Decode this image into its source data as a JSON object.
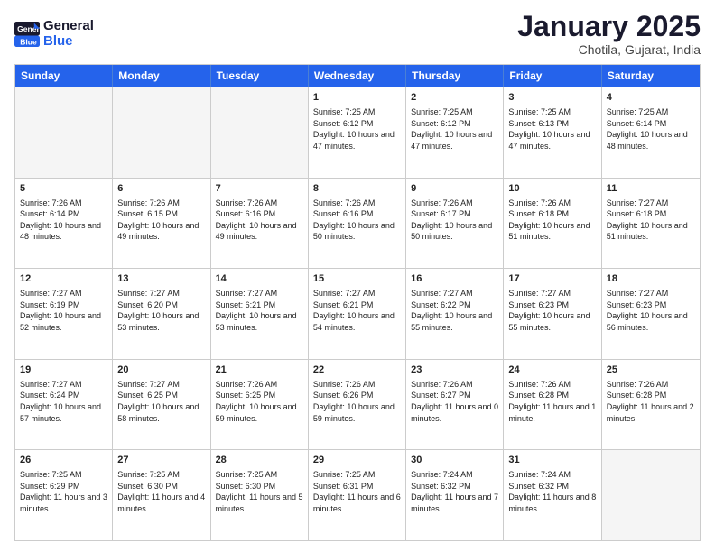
{
  "logo": {
    "text1": "General",
    "text2": "Blue"
  },
  "header": {
    "title": "January 2025",
    "location": "Chotila, Gujarat, India"
  },
  "weekdays": [
    "Sunday",
    "Monday",
    "Tuesday",
    "Wednesday",
    "Thursday",
    "Friday",
    "Saturday"
  ],
  "rows": [
    [
      {
        "day": "",
        "sunrise": "",
        "sunset": "",
        "daylight": "",
        "empty": true
      },
      {
        "day": "",
        "sunrise": "",
        "sunset": "",
        "daylight": "",
        "empty": true
      },
      {
        "day": "",
        "sunrise": "",
        "sunset": "",
        "daylight": "",
        "empty": true
      },
      {
        "day": "1",
        "sunrise": "Sunrise: 7:25 AM",
        "sunset": "Sunset: 6:12 PM",
        "daylight": "Daylight: 10 hours and 47 minutes.",
        "empty": false
      },
      {
        "day": "2",
        "sunrise": "Sunrise: 7:25 AM",
        "sunset": "Sunset: 6:12 PM",
        "daylight": "Daylight: 10 hours and 47 minutes.",
        "empty": false
      },
      {
        "day": "3",
        "sunrise": "Sunrise: 7:25 AM",
        "sunset": "Sunset: 6:13 PM",
        "daylight": "Daylight: 10 hours and 47 minutes.",
        "empty": false
      },
      {
        "day": "4",
        "sunrise": "Sunrise: 7:25 AM",
        "sunset": "Sunset: 6:14 PM",
        "daylight": "Daylight: 10 hours and 48 minutes.",
        "empty": false
      }
    ],
    [
      {
        "day": "5",
        "sunrise": "Sunrise: 7:26 AM",
        "sunset": "Sunset: 6:14 PM",
        "daylight": "Daylight: 10 hours and 48 minutes.",
        "empty": false
      },
      {
        "day": "6",
        "sunrise": "Sunrise: 7:26 AM",
        "sunset": "Sunset: 6:15 PM",
        "daylight": "Daylight: 10 hours and 49 minutes.",
        "empty": false
      },
      {
        "day": "7",
        "sunrise": "Sunrise: 7:26 AM",
        "sunset": "Sunset: 6:16 PM",
        "daylight": "Daylight: 10 hours and 49 minutes.",
        "empty": false
      },
      {
        "day": "8",
        "sunrise": "Sunrise: 7:26 AM",
        "sunset": "Sunset: 6:16 PM",
        "daylight": "Daylight: 10 hours and 50 minutes.",
        "empty": false
      },
      {
        "day": "9",
        "sunrise": "Sunrise: 7:26 AM",
        "sunset": "Sunset: 6:17 PM",
        "daylight": "Daylight: 10 hours and 50 minutes.",
        "empty": false
      },
      {
        "day": "10",
        "sunrise": "Sunrise: 7:26 AM",
        "sunset": "Sunset: 6:18 PM",
        "daylight": "Daylight: 10 hours and 51 minutes.",
        "empty": false
      },
      {
        "day": "11",
        "sunrise": "Sunrise: 7:27 AM",
        "sunset": "Sunset: 6:18 PM",
        "daylight": "Daylight: 10 hours and 51 minutes.",
        "empty": false
      }
    ],
    [
      {
        "day": "12",
        "sunrise": "Sunrise: 7:27 AM",
        "sunset": "Sunset: 6:19 PM",
        "daylight": "Daylight: 10 hours and 52 minutes.",
        "empty": false
      },
      {
        "day": "13",
        "sunrise": "Sunrise: 7:27 AM",
        "sunset": "Sunset: 6:20 PM",
        "daylight": "Daylight: 10 hours and 53 minutes.",
        "empty": false
      },
      {
        "day": "14",
        "sunrise": "Sunrise: 7:27 AM",
        "sunset": "Sunset: 6:21 PM",
        "daylight": "Daylight: 10 hours and 53 minutes.",
        "empty": false
      },
      {
        "day": "15",
        "sunrise": "Sunrise: 7:27 AM",
        "sunset": "Sunset: 6:21 PM",
        "daylight": "Daylight: 10 hours and 54 minutes.",
        "empty": false
      },
      {
        "day": "16",
        "sunrise": "Sunrise: 7:27 AM",
        "sunset": "Sunset: 6:22 PM",
        "daylight": "Daylight: 10 hours and 55 minutes.",
        "empty": false
      },
      {
        "day": "17",
        "sunrise": "Sunrise: 7:27 AM",
        "sunset": "Sunset: 6:23 PM",
        "daylight": "Daylight: 10 hours and 55 minutes.",
        "empty": false
      },
      {
        "day": "18",
        "sunrise": "Sunrise: 7:27 AM",
        "sunset": "Sunset: 6:23 PM",
        "daylight": "Daylight: 10 hours and 56 minutes.",
        "empty": false
      }
    ],
    [
      {
        "day": "19",
        "sunrise": "Sunrise: 7:27 AM",
        "sunset": "Sunset: 6:24 PM",
        "daylight": "Daylight: 10 hours and 57 minutes.",
        "empty": false
      },
      {
        "day": "20",
        "sunrise": "Sunrise: 7:27 AM",
        "sunset": "Sunset: 6:25 PM",
        "daylight": "Daylight: 10 hours and 58 minutes.",
        "empty": false
      },
      {
        "day": "21",
        "sunrise": "Sunrise: 7:26 AM",
        "sunset": "Sunset: 6:25 PM",
        "daylight": "Daylight: 10 hours and 59 minutes.",
        "empty": false
      },
      {
        "day": "22",
        "sunrise": "Sunrise: 7:26 AM",
        "sunset": "Sunset: 6:26 PM",
        "daylight": "Daylight: 10 hours and 59 minutes.",
        "empty": false
      },
      {
        "day": "23",
        "sunrise": "Sunrise: 7:26 AM",
        "sunset": "Sunset: 6:27 PM",
        "daylight": "Daylight: 11 hours and 0 minutes.",
        "empty": false
      },
      {
        "day": "24",
        "sunrise": "Sunrise: 7:26 AM",
        "sunset": "Sunset: 6:28 PM",
        "daylight": "Daylight: 11 hours and 1 minute.",
        "empty": false
      },
      {
        "day": "25",
        "sunrise": "Sunrise: 7:26 AM",
        "sunset": "Sunset: 6:28 PM",
        "daylight": "Daylight: 11 hours and 2 minutes.",
        "empty": false
      }
    ],
    [
      {
        "day": "26",
        "sunrise": "Sunrise: 7:25 AM",
        "sunset": "Sunset: 6:29 PM",
        "daylight": "Daylight: 11 hours and 3 minutes.",
        "empty": false
      },
      {
        "day": "27",
        "sunrise": "Sunrise: 7:25 AM",
        "sunset": "Sunset: 6:30 PM",
        "daylight": "Daylight: 11 hours and 4 minutes.",
        "empty": false
      },
      {
        "day": "28",
        "sunrise": "Sunrise: 7:25 AM",
        "sunset": "Sunset: 6:30 PM",
        "daylight": "Daylight: 11 hours and 5 minutes.",
        "empty": false
      },
      {
        "day": "29",
        "sunrise": "Sunrise: 7:25 AM",
        "sunset": "Sunset: 6:31 PM",
        "daylight": "Daylight: 11 hours and 6 minutes.",
        "empty": false
      },
      {
        "day": "30",
        "sunrise": "Sunrise: 7:24 AM",
        "sunset": "Sunset: 6:32 PM",
        "daylight": "Daylight: 11 hours and 7 minutes.",
        "empty": false
      },
      {
        "day": "31",
        "sunrise": "Sunrise: 7:24 AM",
        "sunset": "Sunset: 6:32 PM",
        "daylight": "Daylight: 11 hours and 8 minutes.",
        "empty": false
      },
      {
        "day": "",
        "sunrise": "",
        "sunset": "",
        "daylight": "",
        "empty": true
      }
    ]
  ]
}
